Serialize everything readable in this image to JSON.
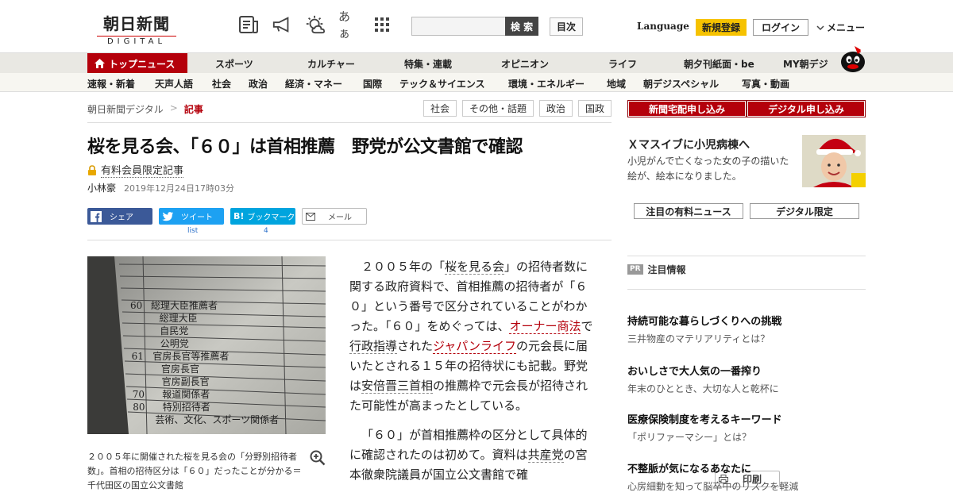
{
  "header": {
    "logo_jp": "朝日新聞",
    "logo_en": "DIGITAL",
    "icons": [
      "newspaper-icon",
      "megaphone-icon",
      "weather-icon",
      "font-size-icon",
      "grid-icon"
    ],
    "font_icon_text": "あぁ",
    "search_placeholder": "",
    "search_button": "検 索",
    "toc": "目次",
    "language": "Language",
    "register": "新規登録",
    "login": "ログイン",
    "menu": "メニュー"
  },
  "nav_main": {
    "top_news": "トップニュース",
    "items": [
      "スポーツ",
      "カルチャー",
      "特集・連載",
      "オピニオン",
      "ライフ",
      "朝夕刊紙面・be",
      "MY朝デジ"
    ]
  },
  "nav_sub": [
    "速報・新着",
    "天声人語",
    "社会",
    "政治",
    "経済・マネー",
    "国際",
    "テック＆サイエンス",
    "環境・エネルギー",
    "地域",
    "朝デジスペシャル",
    "写真・動画"
  ],
  "breadcrumb": {
    "home": "朝日新聞デジタル",
    "sep": ">",
    "current": "記事"
  },
  "tags": [
    "社会",
    "その他・話題",
    "政治",
    "国政"
  ],
  "article": {
    "title": "桜を見る会、「６０」は首相推薦　野党が公文書館で確認",
    "paid_label": "有料会員限定記事",
    "author": "小林豪",
    "datetime": "2019年12月24日17時03分",
    "share": {
      "facebook": "シェア",
      "twitter": "ツイート",
      "hatena": "ブックマーク",
      "mail": "メール",
      "print": "印刷",
      "twitter_count": "list",
      "hatena_count": "4"
    },
    "caption": "２００５年に開催された桜を見る会の「分野別招待者数」。首相の招待区分は「６０」だったことが分かる＝千代田区の国立公文書館",
    "p1": {
      "a": "２００５年の「",
      "l1": "桜を見る会",
      "b": "」の招待者数に関する政府資料で、首相推薦の招待者が「６０」という番号で区分されていることがわかった。「６０」をめぐっては、",
      "l2": "オーナー商法",
      "c": "で",
      "l3": "行政指導",
      "d": "された",
      "l4": "ジャパンライフ",
      "e": "の元会長に届いたとされる１５年の招待状にも記載。野党は",
      "l5": "安倍晋三首相",
      "f": "の推薦枠で元会長が招待された可能性が高まったとしている。"
    },
    "p2": {
      "a": "「６０」が首相推薦枠の区分として具体的に確認されたのは初めて。資料は",
      "l1": "共産党",
      "b": "の宮本徹衆院議員が国立公文書館で確"
    }
  },
  "photo_rows": [
    [
      "総理大臣推薦者",
      "60"
    ],
    [
      "総理大臣",
      ""
    ],
    [
      "自民党",
      ""
    ],
    [
      "公明党",
      ""
    ],
    [
      "官房長官等推薦者",
      "61"
    ],
    [
      "官房長官",
      ""
    ],
    [
      "官房副長官",
      ""
    ],
    [
      "報道関係者",
      "70"
    ],
    [
      "特別招待者",
      "80"
    ],
    [
      "芸術、文化、スポーツ関係者",
      ""
    ]
  ],
  "sidebar": {
    "subscribe_paper": "新聞宅配申し込み",
    "subscribe_digital": "デジタル申し込み",
    "promo_title": "Ｘマスイブに小児病棟へ",
    "promo_text": "小児がんで亡くなった女の子の描いた絵が、絵本になりました。",
    "btn_paid_news": "注目の有料ニュース",
    "btn_digital_only": "デジタル限定",
    "pr_badge": "PR",
    "pr_title": "注目情報",
    "pr_items": [
      {
        "title": "持続可能な暮らしづくりへの挑戦",
        "sub": "三井物産のマテリアリティとは？"
      },
      {
        "title": "おいしさで大人気の一番搾り",
        "sub": "年末のひととき、大切な人と乾杯に"
      },
      {
        "title": "医療保険制度を考えるキーワード",
        "sub": "「ポリファーマシー」とは？"
      },
      {
        "title": "不整脈が気になるあなたに",
        "sub": "心房細動を知って脳卒中のリスクを軽減"
      }
    ]
  },
  "colors": {
    "brand_red": "#b4000b",
    "register_yellow": "#f6c200",
    "facebook": "#3b5998",
    "twitter": "#1da1f2",
    "hatena": "#00a4de"
  }
}
